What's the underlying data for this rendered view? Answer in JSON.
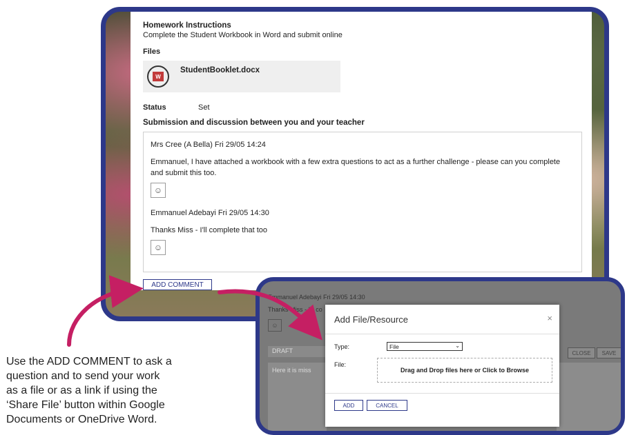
{
  "homework": {
    "title": "Homework Instructions",
    "instructions": "Complete the Student Workbook in Word and submit online",
    "files_label": "Files",
    "file_name": "StudentBooklet.docx",
    "status_label": "Status",
    "status_value": "Set",
    "submission_title": "Submission and discussion between you and your teacher"
  },
  "messages": [
    {
      "meta": "Mrs Cree (A Bella) Fri 29/05 14:24",
      "text": "Emmanuel, I have attached a workbook with a few extra questions to act as a further challenge - please can you complete and submit this too."
    },
    {
      "meta": "Emmanuel Adebayi Fri 29/05 14:30",
      "text": "Thanks Miss - I'll complete that too"
    }
  ],
  "add_comment_label": "ADD COMMENT",
  "dialog_bg": {
    "meta": "Emmanuel Adebayi Fri 29/05 14:30",
    "thanks": "Thanks Miss - I'll co",
    "draft_label": "DRAFT",
    "draft_text": "Here it is miss",
    "close_label": "CLOSE",
    "save_label": "SAVE"
  },
  "dialog": {
    "title": "Add File/Resource",
    "close_glyph": "×",
    "type_label": "Type:",
    "type_value": "File",
    "file_label": "File:",
    "dropzone_text": "Drag and Drop files here or Click to Browse",
    "add_label": "ADD",
    "cancel_label": "CANCEL"
  },
  "caption": "Use the ADD COMMENT to ask a\nquestion and to send your work\nas a file or as a link if using the\n‘Share File’ button within Google\nDocuments or OneDrive Word.",
  "colors": {
    "frame_border": "#2d3889",
    "arrow": "#c51f63"
  }
}
